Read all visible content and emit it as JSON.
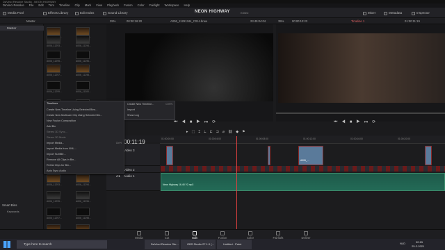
{
  "window_title": "DaVinci Resolve Studio - NEON HIGHWAY",
  "menu": [
    "DaVinci Resolve",
    "File",
    "Edit",
    "Trim",
    "Timeline",
    "Clip",
    "Mark",
    "View",
    "Playback",
    "Fusion",
    "Color",
    "Fairlight",
    "Workspace",
    "Help"
  ],
  "toolbar": {
    "media_pool": "Media Pool",
    "effects_library": "Effects Library",
    "edit_index": "Edit Index",
    "sound_library": "Sound Library",
    "mixer": "Mixer",
    "metadata": "Metadata",
    "inspector": "Inspector"
  },
  "project": {
    "name": "NEON HIGHWAY",
    "status": "Edited"
  },
  "bar2": {
    "master": "Master",
    "zoom_left": "35%",
    "tc_left": "00:00:16:20",
    "clip_name": "A006_11291344_C014.braw",
    "tc_mid": "23:45:04:04",
    "zoom_mid": "35%",
    "tc_right": "00:00:13:23",
    "timeline_name": "Timeline 1",
    "tc_far": "01:00:11:19"
  },
  "sidebar": {
    "master": "Master",
    "smart_bins": "Smart Bins",
    "keywords": "Keywords",
    "app_logo": "DaVinci Resolve 16"
  },
  "clip_labels": [
    "A006_11291...",
    "A006_11292...",
    "A006_11293...",
    "A006_11294...",
    "A006_11295...",
    "A006_11296...",
    "A006_11297...",
    "A006_11298...",
    "A006_11299...",
    "A006_11300..."
  ],
  "context_menu": {
    "header": "Timelines",
    "items": [
      {
        "label": "Create New Timeline Using Selected Bins...",
        "dim": false
      },
      {
        "label": "Create New Multicam Clip Using Selected Bin...",
        "dim": false
      },
      {
        "label": "New Fusion Composition",
        "dim": false
      },
      {
        "label": "Add Bin",
        "dim": false
      },
      {
        "label": "Stereo 3D Sync...",
        "dim": true
      },
      {
        "label": "Stereo 3D Mode",
        "dim": true
      },
      {
        "label": "Import Media...",
        "dim": false,
        "shortcut": "Ctrl+I"
      },
      {
        "label": "Import Media from XML...",
        "dim": false
      },
      {
        "label": "Import Subtitle...",
        "dim": false
      },
      {
        "label": "Remove All Clips in Bin...",
        "dim": false
      },
      {
        "label": "Relink Clips for Bin...",
        "dim": false
      },
      {
        "label": "Auto Sync Audio",
        "dim": false
      }
    ]
  },
  "submenu": {
    "items": [
      {
        "label": "Create New Timeline...",
        "shortcut": "Ctrl+N"
      },
      {
        "label": "Import"
      },
      {
        "label": "Show Log"
      }
    ]
  },
  "timeline": {
    "timecode": "01:00:11:19",
    "video3": "Video 3",
    "video2": "Video 2",
    "audio1": "Audio 1",
    "a1": "A1",
    "v_clip": "A006_...",
    "audio_clip": "Neon Highway 16-48 V2.mp3",
    "ruler": [
      "01:00:00:00",
      "01:00:04:00",
      "01:00:08:00",
      "01:00:12:00",
      "01:00:16:00",
      "01:00:20:00",
      "01:00:24:00"
    ]
  },
  "pages": [
    "Media",
    "Cut",
    "Edit",
    "Fusion",
    "Color",
    "Fairlight",
    "Deliver"
  ],
  "taskbar": {
    "search": "Type here to search",
    "apps": [
      "DaVinci Resolve Stu...",
      "OBS Studio 27.1.0 (...",
      "Untitled - Paint"
    ],
    "lang": "NLD",
    "time": "00:15",
    "date": "25-2-2021"
  },
  "colors": {
    "accent": "#e04040",
    "audio": "#236a56",
    "video": "#5a7a9a"
  }
}
